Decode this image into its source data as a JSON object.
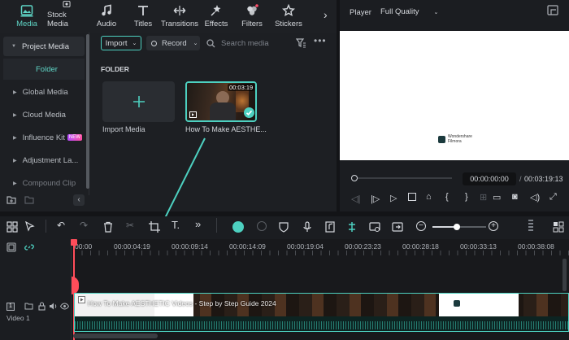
{
  "toolbar": {
    "items": [
      {
        "label": "Media",
        "icon": "media-icon",
        "active": true
      },
      {
        "label": "Stock Media",
        "icon": "stock-media-icon"
      },
      {
        "label": "Audio",
        "icon": "music-note-icon"
      },
      {
        "label": "Titles",
        "icon": "titles-icon"
      },
      {
        "label": "Transitions",
        "icon": "transitions-icon"
      },
      {
        "label": "Effects",
        "icon": "effects-icon"
      },
      {
        "label": "Filters",
        "icon": "filters-icon"
      },
      {
        "label": "Stickers",
        "icon": "stickers-icon"
      }
    ],
    "more": "›"
  },
  "sidebar": {
    "project_media": "Project Media",
    "folder": "Folder",
    "items": [
      "Global Media",
      "Cloud Media",
      "Influence Kit",
      "Adjustment La...",
      "Compound Clip"
    ],
    "badge": "NEW"
  },
  "media": {
    "import_label": "Import",
    "record_label": "Record",
    "search_placeholder": "Search media",
    "folder_heading": "FOLDER",
    "import_media_label": "Import Media",
    "clip_name": "How To Make AESTHE...",
    "clip_duration": "00:03:19"
  },
  "player": {
    "label": "Player",
    "quality": "Full Quality",
    "watermark_line1": "Wondershare",
    "watermark_line2": "Filmora",
    "current_time": "00:00:00:00",
    "separator": "/",
    "total_time": "00:03:19:13"
  },
  "timeline": {
    "ruler": [
      "00:00",
      "00:00:04:19",
      "00:00:09:14",
      "00:00:14:09",
      "00:00:19:04",
      "00:00:23:23",
      "00:00:28:18",
      "00:00:33:13",
      "00:00:38:08"
    ],
    "track_number": "1",
    "track_name": "Video 1",
    "clip_title": "How To Make AESTHETIC Videos - Step by Step Guide 2024",
    "accent_color": "#5fd5c6"
  }
}
